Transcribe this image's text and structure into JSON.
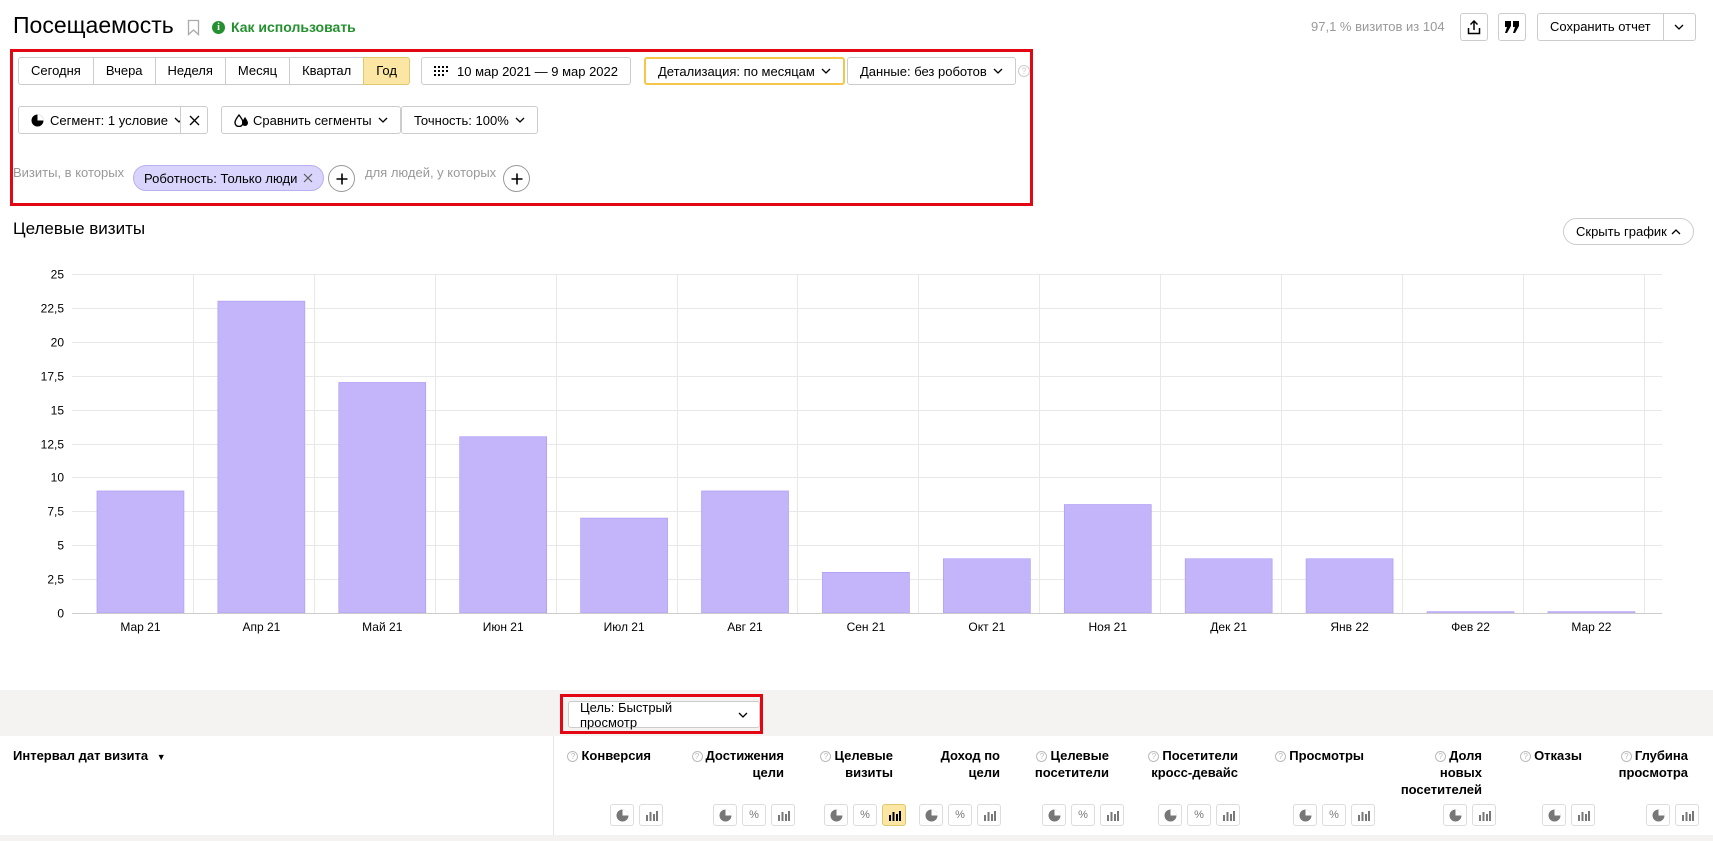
{
  "header": {
    "title": "Посещаемость",
    "howto": "Как использовать",
    "visits_info": "97,1 % визитов из 104",
    "save_report": "Сохранить отчет"
  },
  "periods": [
    "Сегодня",
    "Вчера",
    "Неделя",
    "Месяц",
    "Квартал",
    "Год"
  ],
  "active_period": "Год",
  "filters": {
    "date_range": "10 мар 2021 — 9 мар 2022",
    "detail": "Детализация: по месяцам",
    "data": "Данные: без роботов",
    "segment": "Сегмент: 1 условие",
    "compare": "Сравнить сегменты",
    "accuracy": "Точность: 100%",
    "visits_where": "Визиты, в которых",
    "chip": "Роботность: Только люди",
    "people_where": "для людей, у которых"
  },
  "chart_section": {
    "title": "Целевые визиты",
    "hide_label": "Скрыть график"
  },
  "chart_data": {
    "type": "bar",
    "categories": [
      "Мар 21",
      "Апр 21",
      "Май 21",
      "Июн 21",
      "Июл 21",
      "Авг 21",
      "Сен 21",
      "Окт 21",
      "Ноя 21",
      "Дек 21",
      "Янв 22",
      "Фев 22",
      "Мар 22"
    ],
    "values": [
      9,
      23,
      17,
      13,
      7,
      9,
      3,
      4,
      8,
      4,
      4,
      0.1,
      0.1
    ],
    "y_ticks": [
      "0",
      "2,5",
      "5",
      "7,5",
      "10",
      "12,5",
      "15",
      "17,5",
      "20",
      "22,5",
      "25"
    ],
    "ylim": [
      0,
      25
    ],
    "grid": true,
    "bar_color": "#c4b5fa"
  },
  "goal": {
    "label": "Цель: Быстрый просмотр"
  },
  "table": {
    "first_col": "Интервал дат визита",
    "columns": [
      {
        "label": [
          "Конверсия"
        ],
        "help": true
      },
      {
        "label": [
          "Достижения",
          "цели"
        ],
        "help": true
      },
      {
        "label": [
          "Целевые",
          "визиты"
        ],
        "help": true
      },
      {
        "label": [
          "Доход по",
          "цели"
        ],
        "help": false
      },
      {
        "label": [
          "Целевые",
          "посетители"
        ],
        "help": true
      },
      {
        "label": [
          "Посетители",
          "кросс-девайс"
        ],
        "help": true
      },
      {
        "label": [
          "Просмотры"
        ],
        "help": true
      },
      {
        "label": [
          "Доля",
          "новых",
          "посетителей"
        ],
        "help": true
      },
      {
        "label": [
          "Отказы"
        ],
        "help": true
      },
      {
        "label": [
          "Глубина",
          "просмотра"
        ],
        "help": true
      }
    ],
    "percent_sign": "%"
  }
}
